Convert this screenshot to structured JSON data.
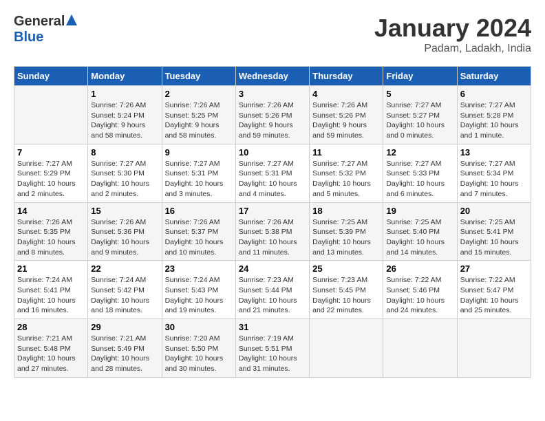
{
  "header": {
    "logo_general": "General",
    "logo_blue": "Blue",
    "month_title": "January 2024",
    "location": "Padam, Ladakh, India"
  },
  "days_of_week": [
    "Sunday",
    "Monday",
    "Tuesday",
    "Wednesday",
    "Thursday",
    "Friday",
    "Saturday"
  ],
  "weeks": [
    [
      {
        "day": "",
        "sunrise": "",
        "sunset": "",
        "daylight": ""
      },
      {
        "day": "1",
        "sunrise": "Sunrise: 7:26 AM",
        "sunset": "Sunset: 5:24 PM",
        "daylight": "Daylight: 9 hours and 58 minutes."
      },
      {
        "day": "2",
        "sunrise": "Sunrise: 7:26 AM",
        "sunset": "Sunset: 5:25 PM",
        "daylight": "Daylight: 9 hours and 58 minutes."
      },
      {
        "day": "3",
        "sunrise": "Sunrise: 7:26 AM",
        "sunset": "Sunset: 5:26 PM",
        "daylight": "Daylight: 9 hours and 59 minutes."
      },
      {
        "day": "4",
        "sunrise": "Sunrise: 7:26 AM",
        "sunset": "Sunset: 5:26 PM",
        "daylight": "Daylight: 9 hours and 59 minutes."
      },
      {
        "day": "5",
        "sunrise": "Sunrise: 7:27 AM",
        "sunset": "Sunset: 5:27 PM",
        "daylight": "Daylight: 10 hours and 0 minutes."
      },
      {
        "day": "6",
        "sunrise": "Sunrise: 7:27 AM",
        "sunset": "Sunset: 5:28 PM",
        "daylight": "Daylight: 10 hours and 1 minute."
      }
    ],
    [
      {
        "day": "7",
        "sunrise": "Sunrise: 7:27 AM",
        "sunset": "Sunset: 5:29 PM",
        "daylight": "Daylight: 10 hours and 2 minutes."
      },
      {
        "day": "8",
        "sunrise": "Sunrise: 7:27 AM",
        "sunset": "Sunset: 5:30 PM",
        "daylight": "Daylight: 10 hours and 2 minutes."
      },
      {
        "day": "9",
        "sunrise": "Sunrise: 7:27 AM",
        "sunset": "Sunset: 5:31 PM",
        "daylight": "Daylight: 10 hours and 3 minutes."
      },
      {
        "day": "10",
        "sunrise": "Sunrise: 7:27 AM",
        "sunset": "Sunset: 5:31 PM",
        "daylight": "Daylight: 10 hours and 4 minutes."
      },
      {
        "day": "11",
        "sunrise": "Sunrise: 7:27 AM",
        "sunset": "Sunset: 5:32 PM",
        "daylight": "Daylight: 10 hours and 5 minutes."
      },
      {
        "day": "12",
        "sunrise": "Sunrise: 7:27 AM",
        "sunset": "Sunset: 5:33 PM",
        "daylight": "Daylight: 10 hours and 6 minutes."
      },
      {
        "day": "13",
        "sunrise": "Sunrise: 7:27 AM",
        "sunset": "Sunset: 5:34 PM",
        "daylight": "Daylight: 10 hours and 7 minutes."
      }
    ],
    [
      {
        "day": "14",
        "sunrise": "Sunrise: 7:26 AM",
        "sunset": "Sunset: 5:35 PM",
        "daylight": "Daylight: 10 hours and 8 minutes."
      },
      {
        "day": "15",
        "sunrise": "Sunrise: 7:26 AM",
        "sunset": "Sunset: 5:36 PM",
        "daylight": "Daylight: 10 hours and 9 minutes."
      },
      {
        "day": "16",
        "sunrise": "Sunrise: 7:26 AM",
        "sunset": "Sunset: 5:37 PM",
        "daylight": "Daylight: 10 hours and 10 minutes."
      },
      {
        "day": "17",
        "sunrise": "Sunrise: 7:26 AM",
        "sunset": "Sunset: 5:38 PM",
        "daylight": "Daylight: 10 hours and 11 minutes."
      },
      {
        "day": "18",
        "sunrise": "Sunrise: 7:25 AM",
        "sunset": "Sunset: 5:39 PM",
        "daylight": "Daylight: 10 hours and 13 minutes."
      },
      {
        "day": "19",
        "sunrise": "Sunrise: 7:25 AM",
        "sunset": "Sunset: 5:40 PM",
        "daylight": "Daylight: 10 hours and 14 minutes."
      },
      {
        "day": "20",
        "sunrise": "Sunrise: 7:25 AM",
        "sunset": "Sunset: 5:41 PM",
        "daylight": "Daylight: 10 hours and 15 minutes."
      }
    ],
    [
      {
        "day": "21",
        "sunrise": "Sunrise: 7:24 AM",
        "sunset": "Sunset: 5:41 PM",
        "daylight": "Daylight: 10 hours and 16 minutes."
      },
      {
        "day": "22",
        "sunrise": "Sunrise: 7:24 AM",
        "sunset": "Sunset: 5:42 PM",
        "daylight": "Daylight: 10 hours and 18 minutes."
      },
      {
        "day": "23",
        "sunrise": "Sunrise: 7:24 AM",
        "sunset": "Sunset: 5:43 PM",
        "daylight": "Daylight: 10 hours and 19 minutes."
      },
      {
        "day": "24",
        "sunrise": "Sunrise: 7:23 AM",
        "sunset": "Sunset: 5:44 PM",
        "daylight": "Daylight: 10 hours and 21 minutes."
      },
      {
        "day": "25",
        "sunrise": "Sunrise: 7:23 AM",
        "sunset": "Sunset: 5:45 PM",
        "daylight": "Daylight: 10 hours and 22 minutes."
      },
      {
        "day": "26",
        "sunrise": "Sunrise: 7:22 AM",
        "sunset": "Sunset: 5:46 PM",
        "daylight": "Daylight: 10 hours and 24 minutes."
      },
      {
        "day": "27",
        "sunrise": "Sunrise: 7:22 AM",
        "sunset": "Sunset: 5:47 PM",
        "daylight": "Daylight: 10 hours and 25 minutes."
      }
    ],
    [
      {
        "day": "28",
        "sunrise": "Sunrise: 7:21 AM",
        "sunset": "Sunset: 5:48 PM",
        "daylight": "Daylight: 10 hours and 27 minutes."
      },
      {
        "day": "29",
        "sunrise": "Sunrise: 7:21 AM",
        "sunset": "Sunset: 5:49 PM",
        "daylight": "Daylight: 10 hours and 28 minutes."
      },
      {
        "day": "30",
        "sunrise": "Sunrise: 7:20 AM",
        "sunset": "Sunset: 5:50 PM",
        "daylight": "Daylight: 10 hours and 30 minutes."
      },
      {
        "day": "31",
        "sunrise": "Sunrise: 7:19 AM",
        "sunset": "Sunset: 5:51 PM",
        "daylight": "Daylight: 10 hours and 31 minutes."
      },
      {
        "day": "",
        "sunrise": "",
        "sunset": "",
        "daylight": ""
      },
      {
        "day": "",
        "sunrise": "",
        "sunset": "",
        "daylight": ""
      },
      {
        "day": "",
        "sunrise": "",
        "sunset": "",
        "daylight": ""
      }
    ]
  ]
}
